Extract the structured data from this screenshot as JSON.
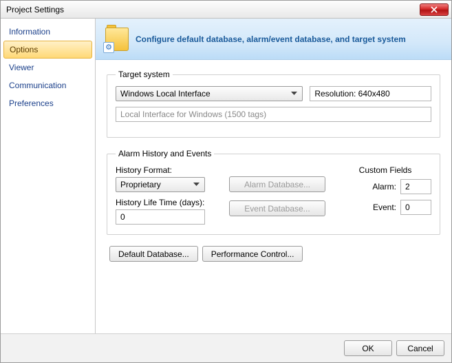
{
  "window": {
    "title": "Project Settings"
  },
  "sidebar": {
    "items": [
      {
        "label": "Information"
      },
      {
        "label": "Options"
      },
      {
        "label": "Viewer"
      },
      {
        "label": "Communication"
      },
      {
        "label": "Preferences"
      }
    ],
    "active_index": 1
  },
  "header": {
    "text": "Configure default database, alarm/event database, and target system",
    "icon_badge": "⚙"
  },
  "target_system": {
    "legend": "Target system",
    "selected": "Windows Local Interface",
    "resolution_label": "Resolution: 640x480",
    "description": "Local Interface for Windows (1500 tags)"
  },
  "alarm": {
    "legend": "Alarm History and Events",
    "history_format_label": "History Format:",
    "history_format_value": "Proprietary",
    "history_life_label": "History Life Time (days):",
    "history_life_value": "0",
    "alarm_db_btn": "Alarm Database...",
    "event_db_btn": "Event Database...",
    "custom_fields_title": "Custom Fields",
    "alarm_label": "Alarm:",
    "alarm_value": "2",
    "event_label": "Event:",
    "event_value": "0"
  },
  "buttons": {
    "default_db": "Default Database...",
    "perf": "Performance Control...",
    "ok": "OK",
    "cancel": "Cancel"
  }
}
